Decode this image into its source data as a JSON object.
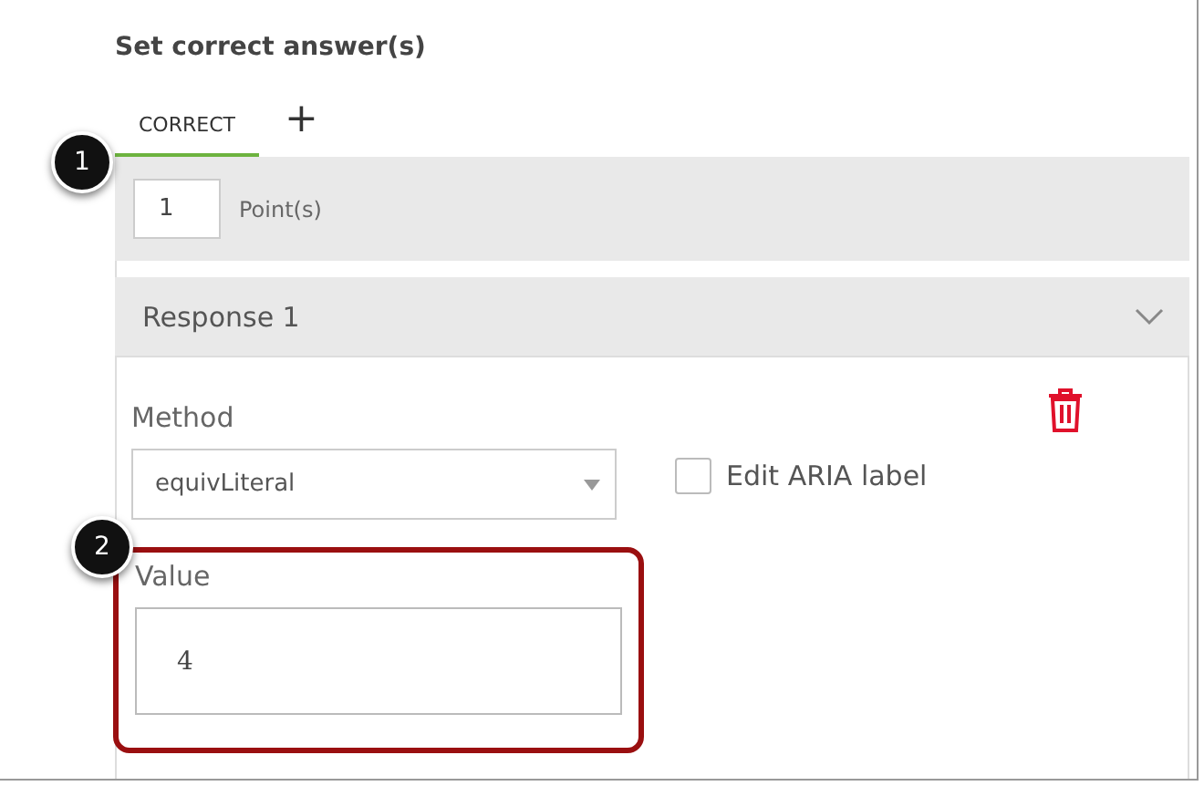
{
  "heading": "Set correct answer(s)",
  "tabs": [
    {
      "label": "CORRECT",
      "selected": true
    }
  ],
  "add_tab": "+",
  "points": {
    "value": "1",
    "label": "Point(s)"
  },
  "response": {
    "title": "Response 1",
    "expanded": true
  },
  "method": {
    "label": "Method",
    "value": "equivLiteral"
  },
  "aria_checkbox": {
    "label": "Edit ARIA label",
    "checked": false
  },
  "value_field": {
    "label": "Value",
    "value": "4"
  },
  "callouts": [
    "1",
    "2"
  ]
}
